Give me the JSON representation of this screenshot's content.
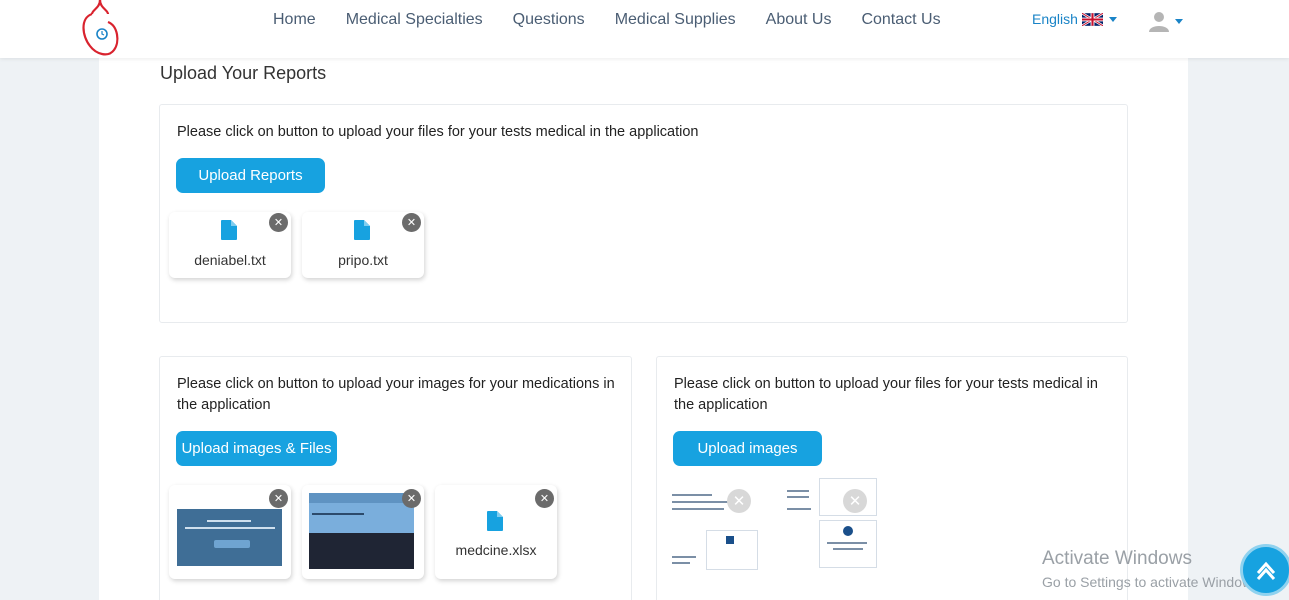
{
  "nav": {
    "links": [
      "Home",
      "Medical Specialties",
      "Questions",
      "Medical Supplies",
      "About Us",
      "Contact Us"
    ],
    "language": "English",
    "flag_icon": "uk-flag-icon",
    "user_icon": "user-avatar-icon"
  },
  "page": {
    "title": "Upload Your Reports"
  },
  "reports": {
    "text": "Please click on button to upload your files for your tests medical in the application",
    "button": "Upload Reports",
    "files": [
      "deniabel.txt",
      "pripo.txt"
    ]
  },
  "medications": {
    "text": "Please click on button to upload your images for your medications in the application",
    "button": "Upload images & Files",
    "files": [
      "medcine.xlsx"
    ]
  },
  "tests": {
    "text": "Please click on button to upload your files for your tests medical in the application",
    "button": "Upload images"
  },
  "watermark": {
    "title": "Activate Windows",
    "subtitle": "Go to Settings to activate Windows."
  },
  "colors": {
    "accent": "#17a2e0",
    "nav_text": "#4a5d73",
    "logo_red": "#d9232e"
  }
}
